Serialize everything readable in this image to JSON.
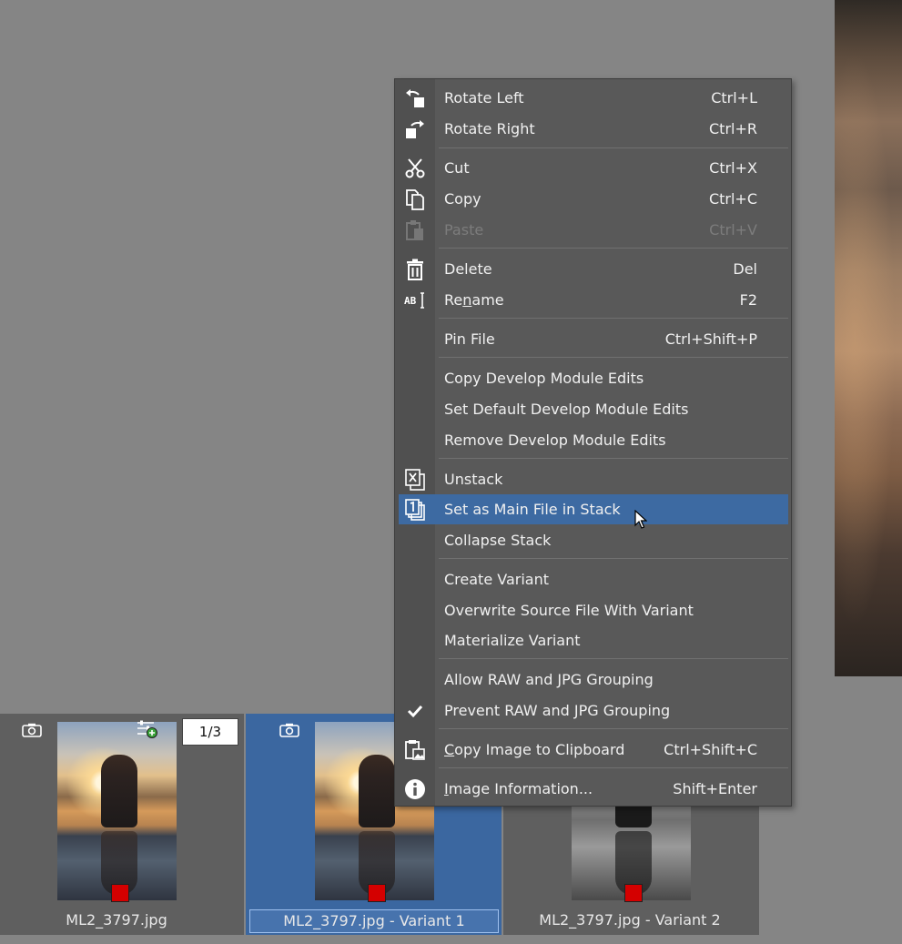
{
  "menu": {
    "items": [
      {
        "label": "Rotate Left",
        "shortcut": "Ctrl+L",
        "icon": "rotate-left-icon"
      },
      {
        "label": "Rotate Right",
        "shortcut": "Ctrl+R",
        "icon": "rotate-right-icon"
      },
      {
        "label": "Cut",
        "shortcut": "Ctrl+X",
        "icon": "scissors-icon"
      },
      {
        "label": "Copy",
        "shortcut": "Ctrl+C",
        "icon": "copy-icon"
      },
      {
        "label": "Paste",
        "shortcut": "Ctrl+V",
        "icon": "paste-icon",
        "disabled": true
      },
      {
        "label": "Delete",
        "shortcut": "Del",
        "icon": "trash-icon"
      },
      {
        "label_pre": "Re",
        "label_u": "n",
        "label_post": "ame",
        "shortcut": "F2",
        "icon": "rename-icon"
      },
      {
        "label": "Pin File",
        "shortcut": "Ctrl+Shift+P"
      },
      {
        "label": "Copy Develop Module Edits",
        "shortcut": ""
      },
      {
        "label": "Set Default Develop Module Edits",
        "shortcut": ""
      },
      {
        "label": "Remove Develop Module Edits",
        "shortcut": ""
      },
      {
        "label": "Unstack",
        "shortcut": "",
        "icon": "unstack-icon"
      },
      {
        "label": "Set as Main File in Stack",
        "shortcut": "",
        "icon": "stack-main-icon",
        "highlighted": true
      },
      {
        "label": "Collapse Stack",
        "shortcut": ""
      },
      {
        "label": "Create Variant",
        "shortcut": ""
      },
      {
        "label": "Overwrite Source File With Variant",
        "shortcut": ""
      },
      {
        "label": "Materialize Variant",
        "shortcut": ""
      },
      {
        "label": "Allow RAW and JPG Grouping",
        "shortcut": ""
      },
      {
        "label": "Prevent RAW and JPG Grouping",
        "shortcut": "",
        "icon": "checkmark-icon",
        "checked": true
      },
      {
        "label_u": "C",
        "label_post": "opy Image to Clipboard",
        "shortcut": "Ctrl+Shift+C",
        "icon": "clipboard-image-icon"
      },
      {
        "label_u": "I",
        "label_post": "mage Information...",
        "shortcut": "Shift+Enter",
        "icon": "info-icon"
      }
    ]
  },
  "filmstrip": {
    "stack_counter": "1/3",
    "tiles": [
      {
        "filename": "ML2_3797.jpg",
        "selected": false,
        "style": "color"
      },
      {
        "filename": "ML2_3797.jpg - Variant 1",
        "selected": true,
        "style": "color"
      },
      {
        "filename": "ML2_3797.jpg - Variant 2",
        "selected": false,
        "style": "bw"
      }
    ]
  },
  "colors": {
    "highlight": "#3d6aa2",
    "selected_tile": "#3b67a0",
    "color_label_red": "#d40000"
  }
}
